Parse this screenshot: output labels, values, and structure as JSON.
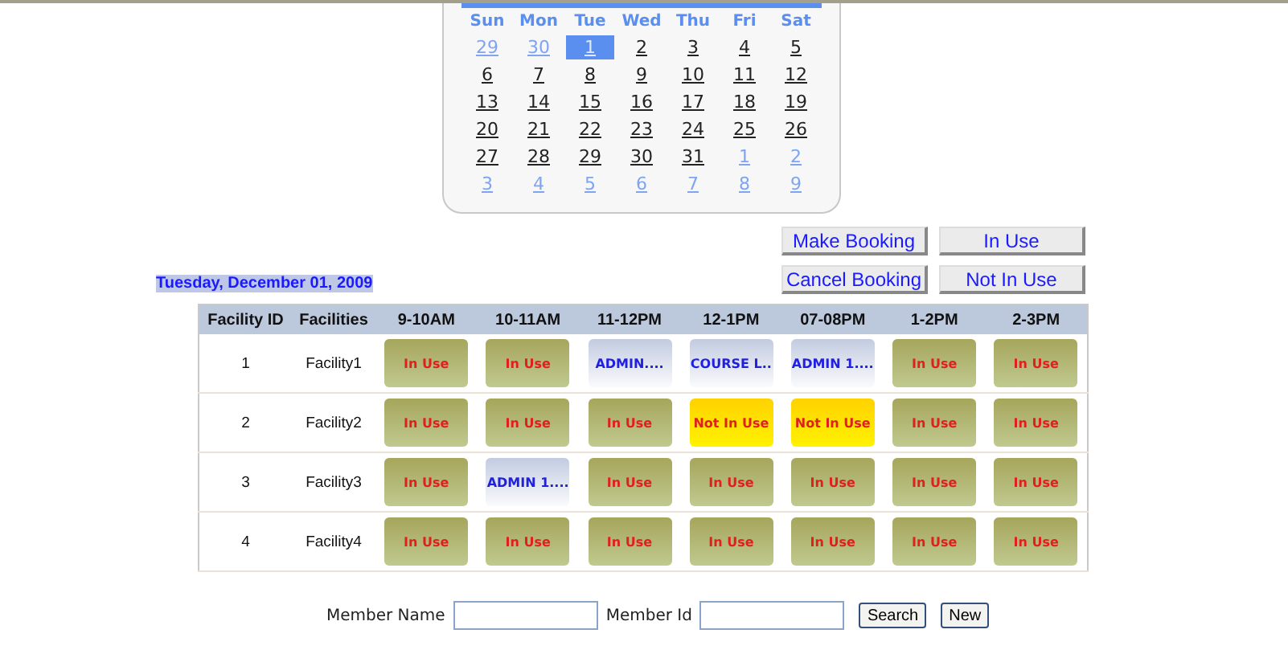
{
  "calendar": {
    "weekdays": [
      "Sun",
      "Mon",
      "Tue",
      "Wed",
      "Thu",
      "Fri",
      "Sat"
    ],
    "weeks": [
      [
        {
          "day": "29",
          "other_month": true,
          "selected": false
        },
        {
          "day": "30",
          "other_month": true,
          "selected": false
        },
        {
          "day": "1",
          "other_month": false,
          "selected": true
        },
        {
          "day": "2",
          "other_month": false,
          "selected": false
        },
        {
          "day": "3",
          "other_month": false,
          "selected": false
        },
        {
          "day": "4",
          "other_month": false,
          "selected": false
        },
        {
          "day": "5",
          "other_month": false,
          "selected": false
        }
      ],
      [
        {
          "day": "6",
          "other_month": false,
          "selected": false
        },
        {
          "day": "7",
          "other_month": false,
          "selected": false
        },
        {
          "day": "8",
          "other_month": false,
          "selected": false
        },
        {
          "day": "9",
          "other_month": false,
          "selected": false
        },
        {
          "day": "10",
          "other_month": false,
          "selected": false
        },
        {
          "day": "11",
          "other_month": false,
          "selected": false
        },
        {
          "day": "12",
          "other_month": false,
          "selected": false
        }
      ],
      [
        {
          "day": "13",
          "other_month": false,
          "selected": false
        },
        {
          "day": "14",
          "other_month": false,
          "selected": false
        },
        {
          "day": "15",
          "other_month": false,
          "selected": false
        },
        {
          "day": "16",
          "other_month": false,
          "selected": false
        },
        {
          "day": "17",
          "other_month": false,
          "selected": false
        },
        {
          "day": "18",
          "other_month": false,
          "selected": false
        },
        {
          "day": "19",
          "other_month": false,
          "selected": false
        }
      ],
      [
        {
          "day": "20",
          "other_month": false,
          "selected": false
        },
        {
          "day": "21",
          "other_month": false,
          "selected": false
        },
        {
          "day": "22",
          "other_month": false,
          "selected": false
        },
        {
          "day": "23",
          "other_month": false,
          "selected": false
        },
        {
          "day": "24",
          "other_month": false,
          "selected": false
        },
        {
          "day": "25",
          "other_month": false,
          "selected": false
        },
        {
          "day": "26",
          "other_month": false,
          "selected": false
        }
      ],
      [
        {
          "day": "27",
          "other_month": false,
          "selected": false
        },
        {
          "day": "28",
          "other_month": false,
          "selected": false
        },
        {
          "day": "29",
          "other_month": false,
          "selected": false
        },
        {
          "day": "30",
          "other_month": false,
          "selected": false
        },
        {
          "day": "31",
          "other_month": false,
          "selected": false
        },
        {
          "day": "1",
          "other_month": true,
          "selected": false
        },
        {
          "day": "2",
          "other_month": true,
          "selected": false
        }
      ],
      [
        {
          "day": "3",
          "other_month": true,
          "selected": false
        },
        {
          "day": "4",
          "other_month": true,
          "selected": false
        },
        {
          "day": "5",
          "other_month": true,
          "selected": false
        },
        {
          "day": "6",
          "other_month": true,
          "selected": false
        },
        {
          "day": "7",
          "other_month": true,
          "selected": false
        },
        {
          "day": "8",
          "other_month": true,
          "selected": false
        },
        {
          "day": "9",
          "other_month": true,
          "selected": false
        }
      ]
    ]
  },
  "actions": [
    [
      "Make Booking",
      "In Use"
    ],
    [
      "Cancel Booking",
      "Not In Use"
    ]
  ],
  "selected_date": "Tuesday, December 01, 2009",
  "table": {
    "columns": [
      "Facility ID",
      "Facilities",
      "9-10AM",
      "10-11AM",
      "11-12PM",
      "12-1PM",
      "07-08PM",
      "1-2PM",
      "2-3PM"
    ],
    "rows": [
      {
        "id": "1",
        "name": "Facility1",
        "slots": [
          {
            "kind": "in_use",
            "label": "In Use"
          },
          {
            "kind": "in_use",
            "label": "In Use"
          },
          {
            "kind": "booked",
            "label": "ADMIN...."
          },
          {
            "kind": "booked",
            "label": "COURSE L.."
          },
          {
            "kind": "booked",
            "label": "ADMIN 1...."
          },
          {
            "kind": "in_use",
            "label": "In Use"
          },
          {
            "kind": "in_use",
            "label": "In Use"
          }
        ]
      },
      {
        "id": "2",
        "name": "Facility2",
        "slots": [
          {
            "kind": "in_use",
            "label": "In Use"
          },
          {
            "kind": "in_use",
            "label": "In Use"
          },
          {
            "kind": "in_use",
            "label": "In Use"
          },
          {
            "kind": "not_in_use",
            "label": "Not In Use"
          },
          {
            "kind": "not_in_use",
            "label": "Not In Use"
          },
          {
            "kind": "in_use",
            "label": "In Use"
          },
          {
            "kind": "in_use",
            "label": "In Use"
          }
        ]
      },
      {
        "id": "3",
        "name": "Facility3",
        "slots": [
          {
            "kind": "in_use",
            "label": "In Use"
          },
          {
            "kind": "booked",
            "label": "ADMIN 1...."
          },
          {
            "kind": "in_use",
            "label": "In Use"
          },
          {
            "kind": "in_use",
            "label": "In Use"
          },
          {
            "kind": "in_use",
            "label": "In Use"
          },
          {
            "kind": "in_use",
            "label": "In Use"
          },
          {
            "kind": "in_use",
            "label": "In Use"
          }
        ]
      },
      {
        "id": "4",
        "name": "Facility4",
        "slots": [
          {
            "kind": "in_use",
            "label": "In Use"
          },
          {
            "kind": "in_use",
            "label": "In Use"
          },
          {
            "kind": "in_use",
            "label": "In Use"
          },
          {
            "kind": "in_use",
            "label": "In Use"
          },
          {
            "kind": "in_use",
            "label": "In Use"
          },
          {
            "kind": "in_use",
            "label": "In Use"
          },
          {
            "kind": "in_use",
            "label": "In Use"
          }
        ]
      }
    ]
  },
  "search": {
    "name_label": "Member Name",
    "id_label": "Member Id",
    "buttons": [
      "Search",
      "New"
    ]
  }
}
